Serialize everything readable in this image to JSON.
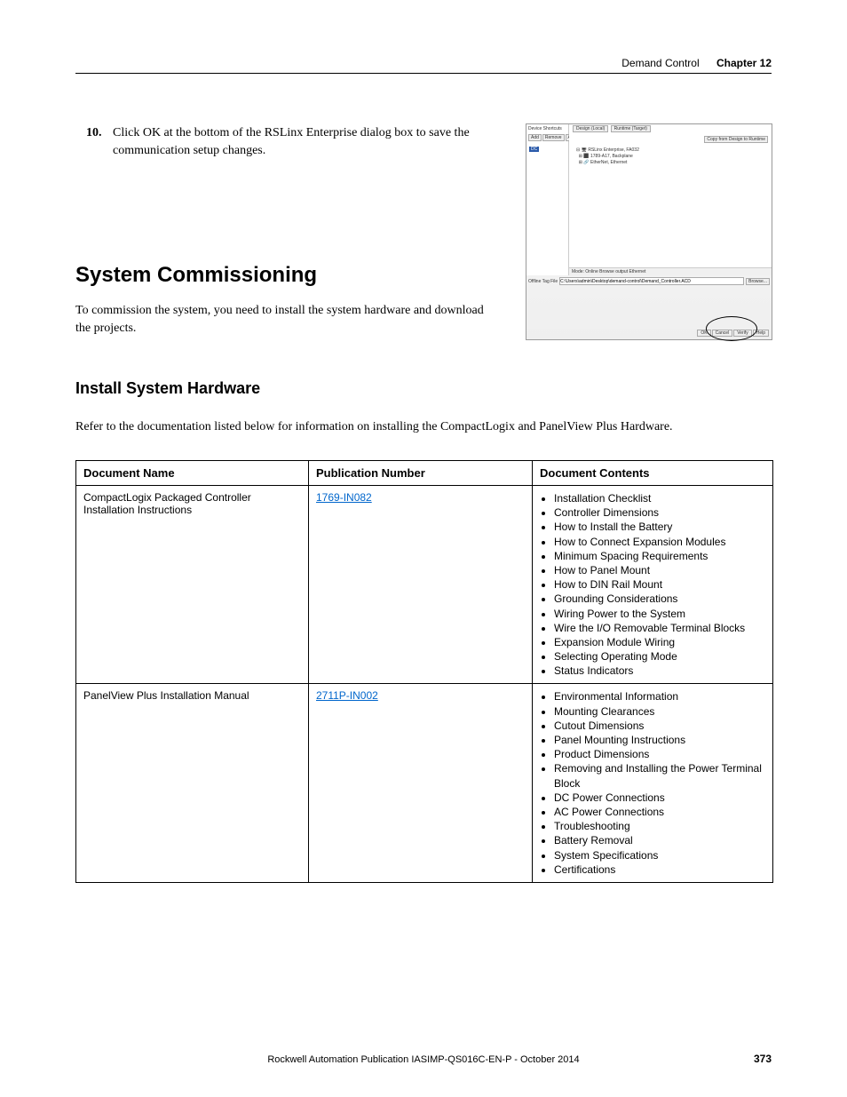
{
  "header": {
    "title": "Demand Control",
    "chapter": "Chapter 12"
  },
  "step": {
    "number": "10.",
    "text": "Click OK at the bottom of the RSLinx Enterprise dialog box to save the communication setup changes."
  },
  "screenshot": {
    "left_tab": "Device Shortcuts",
    "btn_add": "Add",
    "btn_remove": "Remove",
    "btn_apply": "Apply",
    "shortcut_sel": "DC",
    "right_tab1": "Design (Local)",
    "right_tab2": "Runtime (Target)",
    "copy_btn": "Copy from Design to Runtime",
    "tree1": "RSLinx Enterprise, FA032",
    "tree2": "1789-A17, Backplane",
    "tree3": "EtherNet, Ethernet",
    "mode": "Mode: Online   Browse output Ethernet",
    "path_label": "Offline Tag File",
    "path_value": "C:\\Users\\admin\\Desktop\\demand-control\\Demand_Controller.ACD",
    "browse": "Browse...",
    "ok": "OK",
    "cancel": "Cancel",
    "verify": "Verify",
    "help": "Help"
  },
  "headings": {
    "h1": "System Commissioning",
    "h2": "Install System Hardware"
  },
  "paragraphs": {
    "commission": "To commission the system, you need to install the system hardware and download the projects.",
    "refer": "Refer to the documentation listed below for information on installing the CompactLogix and PanelView Plus Hardware."
  },
  "table": {
    "headers": {
      "c1": "Document Name",
      "c2": "Publication Number",
      "c3": "Document Contents"
    },
    "rows": [
      {
        "name": "CompactLogix Packaged Controller Installation Instructions",
        "pub": "1769-IN082",
        "items": [
          "Installation Checklist",
          "Controller Dimensions",
          "How to Install the Battery",
          "How to Connect Expansion Modules",
          "Minimum Spacing Requirements",
          "How to Panel Mount",
          "How to DIN Rail Mount",
          "Grounding Considerations",
          "Wiring Power to the System",
          "Wire the I/O Removable Terminal Blocks",
          "Expansion Module Wiring",
          "Selecting Operating Mode",
          "Status Indicators"
        ]
      },
      {
        "name": "PanelView Plus Installation Manual",
        "pub": "2711P-IN002",
        "items": [
          "Environmental Information",
          "Mounting Clearances",
          "Cutout Dimensions",
          "Panel Mounting Instructions",
          "Product Dimensions",
          "Removing and Installing the Power Terminal Block",
          "DC Power Connections",
          "AC Power Connections",
          "Troubleshooting",
          "Battery Removal",
          "System Specifications",
          "Certifications"
        ]
      }
    ]
  },
  "footer": {
    "pub": "Rockwell Automation Publication IASIMP-QS016C-EN-P - October 2014",
    "page": "373"
  }
}
